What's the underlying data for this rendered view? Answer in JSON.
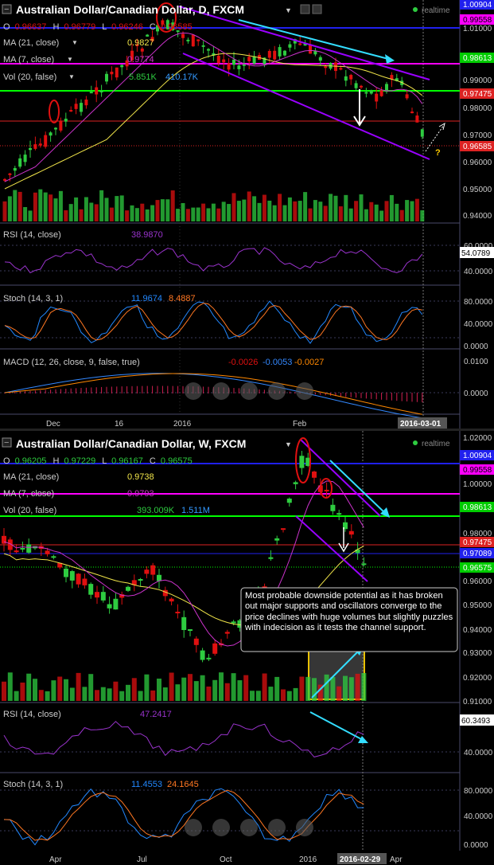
{
  "colors": {
    "bg": "#000000",
    "grid": "#5a5a7a",
    "up": "#2ecc40",
    "down": "#e01010",
    "ma21": "#f2e64a",
    "ma7": "#cc33cc",
    "rsi": "#9933cc",
    "stochK": "#2288ff",
    "stochD": "#ff7722",
    "macd": "#3388ff",
    "signal": "#ff8800",
    "blue_line": "#2020ee",
    "magenta_line": "#ff00ff",
    "green_line": "#00ff00",
    "red_line": "#dd2222",
    "cyan": "#33ddff",
    "channel": "#9900ff",
    "annotation_bg": "#000000"
  },
  "top": {
    "title": "Australian Dollar/Canadian Dollar, D, FXCM",
    "realtime": "realtime",
    "ohlc": {
      "o_label": "O",
      "o": "0.96637",
      "h_label": "H",
      "h": "0.96779",
      "l_label": "L",
      "l": "0.96246",
      "c_label": "C",
      "c": "0.96585"
    },
    "ma21": {
      "label": "MA (21, close)",
      "value": "0.9827"
    },
    "ma7": {
      "label": "MA (7, close)",
      "value": "0.9774"
    },
    "vol": {
      "label": "Vol (20, false)",
      "v1": "5.851K",
      "v2": "410.17K"
    },
    "rsi": {
      "label": "RSI (14, close)",
      "value": "38.9870",
      "axis_value": "54.0789"
    },
    "stoch": {
      "label": "Stoch (14, 3, 1)",
      "k": "11.9674",
      "d": "8.4887"
    },
    "macd": {
      "label": "MACD (12, 26, close, 9, false, true)",
      "v1": "-0.0026",
      "v2": "-0.0053",
      "v3": "-0.0027"
    },
    "price_labels": [
      {
        "text": "1.00904",
        "type": "blue"
      },
      {
        "text": "0.99558",
        "type": "magenta"
      },
      {
        "text": "1.01000",
        "type": "tick"
      },
      {
        "text": "0.98613",
        "type": "green"
      },
      {
        "text": "0.99000",
        "type": "tick"
      },
      {
        "text": "0.97475",
        "type": "red"
      },
      {
        "text": "0.98000",
        "type": "tick"
      },
      {
        "text": "0.97000",
        "type": "tick"
      },
      {
        "text": "0.96585",
        "type": "red"
      },
      {
        "text": "0.96000",
        "type": "tick"
      },
      {
        "text": "0.95000",
        "type": "tick"
      },
      {
        "text": "0.94000",
        "type": "tick"
      }
    ],
    "rsi_ticks": [
      "60.0000",
      "40.0000"
    ],
    "stoch_ticks": [
      "80.0000",
      "40.0000",
      "0.0000"
    ],
    "macd_ticks": [
      "0.0100",
      "0.0000"
    ],
    "x_labels": [
      "Dec",
      "16",
      "2016",
      "Feb"
    ],
    "date_label": "2016-03-01",
    "question": "?"
  },
  "bottom": {
    "title": "Australian Dollar/Canadian Dollar, W, FXCM",
    "realtime": "realtime",
    "ohlc": {
      "o_label": "O",
      "o": "0.96205",
      "h_label": "H",
      "h": "0.97229",
      "l_label": "L",
      "l": "0.96167",
      "c_label": "C",
      "c": "0.96575"
    },
    "ma21": {
      "label": "MA (21, close)",
      "value": "0.9738"
    },
    "ma7": {
      "label": "MA (7, close)",
      "value": "0.9793"
    },
    "vol": {
      "label": "Vol (20, false)",
      "v1": "393.009K",
      "v2": "1.511M"
    },
    "rsi": {
      "label": "RSI (14, close)",
      "value": "47.2417",
      "axis_value": "60.3493"
    },
    "stoch": {
      "label": "Stoch (14, 3, 1)",
      "k": "11.4553",
      "d": "24.1645"
    },
    "price_labels": [
      {
        "text": "1.02000",
        "type": "tick"
      },
      {
        "text": "1.00904",
        "type": "blue"
      },
      {
        "text": "0.99558",
        "type": "magenta"
      },
      {
        "text": "1.00000",
        "type": "tick"
      },
      {
        "text": "0.98613",
        "type": "green"
      },
      {
        "text": "0.98000",
        "type": "tick"
      },
      {
        "text": "0.97475",
        "type": "red"
      },
      {
        "text": "0.97089",
        "type": "blue"
      },
      {
        "text": "0.96575",
        "type": "green"
      },
      {
        "text": "0.96000",
        "type": "tick"
      },
      {
        "text": "0.95000",
        "type": "tick"
      },
      {
        "text": "0.94000",
        "type": "tick"
      },
      {
        "text": "0.93000",
        "type": "tick"
      },
      {
        "text": "0.92000",
        "type": "tick"
      },
      {
        "text": "0.91000",
        "type": "tick"
      }
    ],
    "rsi_ticks": [
      "40.0000"
    ],
    "stoch_ticks": [
      "80.0000",
      "40.0000",
      "0.0000"
    ],
    "x_labels": [
      "Apr",
      "Jul",
      "Oct",
      "2016",
      "Apr"
    ],
    "date_label": "2016-02-29",
    "annotation": "Most probable downside potential as it has broken out major supports and oscillators converge to the price declines with huge volumes but slightly puzzles with indecision as it tests the channel support."
  },
  "chart_data": [
    {
      "type": "candlestick",
      "title": "Australian Dollar/Canadian Dollar, D, FXCM",
      "ylim": [
        0.935,
        1.015
      ],
      "x_ticks": [
        "Dec",
        "16",
        "2016",
        "Feb"
      ],
      "last_close": 0.96585,
      "horizontal_levels": [
        1.00904,
        0.99558,
        0.98613,
        0.97475,
        0.96585
      ],
      "series": [
        {
          "name": "MA (21, close)",
          "last": 0.9827
        },
        {
          "name": "MA (7, close)",
          "last": 0.9774
        }
      ]
    },
    {
      "type": "candlestick",
      "title": "Australian Dollar/Canadian Dollar, W, FXCM",
      "ylim": [
        0.905,
        1.025
      ],
      "x_ticks": [
        "Apr",
        "Jul",
        "Oct",
        "2016",
        "Apr"
      ],
      "last_close": 0.96575,
      "horizontal_levels": [
        1.00904,
        0.99558,
        0.98613,
        0.97475,
        0.97089,
        0.96575
      ],
      "series": [
        {
          "name": "MA (21, close)",
          "last": 0.9738
        },
        {
          "name": "MA (7, close)",
          "last": 0.9793
        }
      ]
    }
  ]
}
